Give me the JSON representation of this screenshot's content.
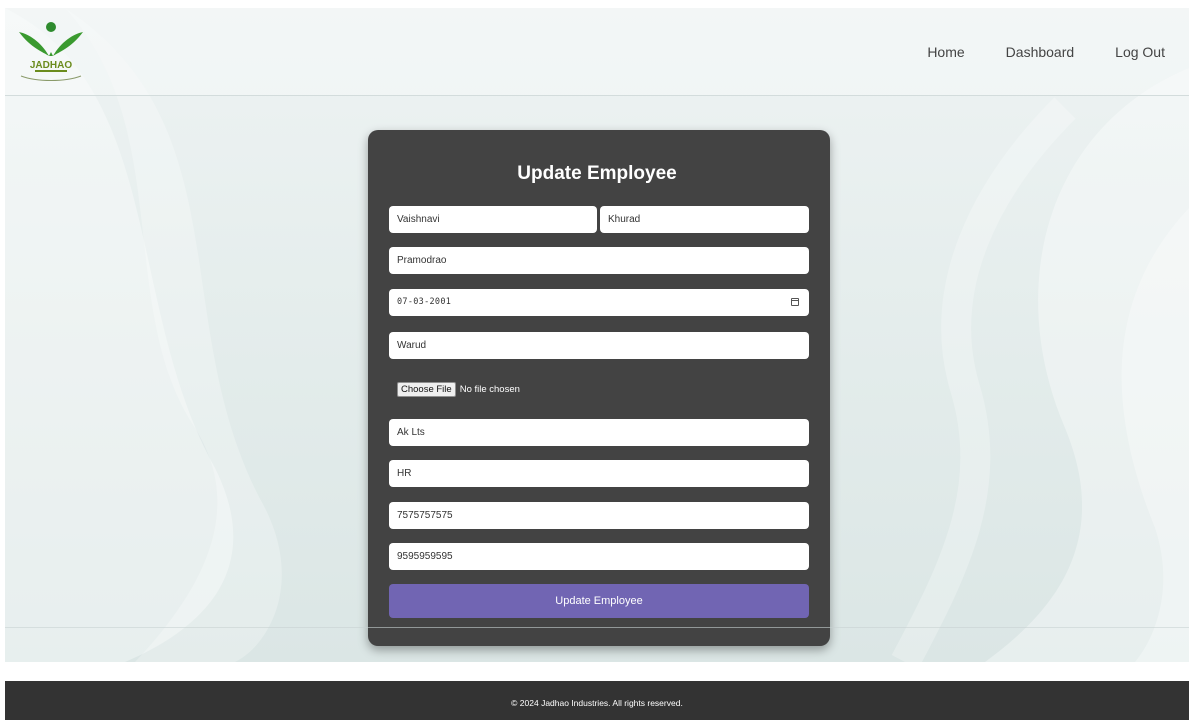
{
  "header": {
    "brand": "JADHAO",
    "nav": [
      "Home",
      "Dashboard",
      "Log Out"
    ]
  },
  "form": {
    "title": "Update Employee",
    "first_name": "Vaishnavi",
    "last_name": "Khurad",
    "middle_name": "Pramodrao",
    "dob": "07-03-2001",
    "address": "Warud",
    "file_button": "Choose File",
    "file_status": "No file chosen",
    "company": "Ak Lts",
    "department": "HR",
    "phone": "7575757575",
    "alt_phone": "9595959595",
    "submit": "Update Employee"
  },
  "footer": {
    "text": "© 2024 Jadhao Industries. All rights reserved."
  },
  "colors": {
    "card": "#434343",
    "button": "#7165b3",
    "footer": "#333333",
    "logo_green": "#2e8b2e",
    "logo_text": "#6b8c1e"
  }
}
